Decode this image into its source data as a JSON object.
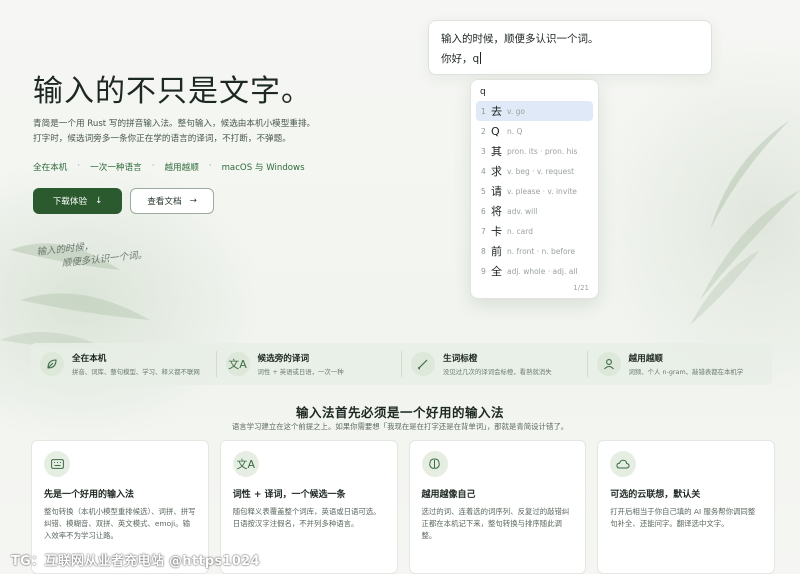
{
  "hero": {
    "title": "输入的不只是文字。",
    "desc_line1": "青简是一个用 Rust 写的拼音输入法。整句输入，候选由本机小模型重排。",
    "desc_line2": "打字时，候选词旁多一条你正在学的语言的译词，不打断，不弹题。",
    "features": [
      "全在本机",
      "一次一种语言",
      "越用越顺",
      "macOS 与 Windows"
    ],
    "download_label": "下载体验",
    "docs_label": "查看文档",
    "handwriting_line1": "输入的时候，",
    "handwriting_line2": "顺便多认识一个词。"
  },
  "demo": {
    "line1": "输入的时候，顺便多认识一个词。",
    "line2": "你好，q",
    "candidate_input": "q",
    "candidates": [
      {
        "num": "1",
        "word": "去",
        "gloss": "v. go"
      },
      {
        "num": "2",
        "word": "Q",
        "gloss": "n. Q"
      },
      {
        "num": "3",
        "word": "其",
        "gloss": "pron. its · pron. his"
      },
      {
        "num": "4",
        "word": "求",
        "gloss": "v. beg · v. request"
      },
      {
        "num": "5",
        "word": "请",
        "gloss": "v. please · v. invite"
      },
      {
        "num": "6",
        "word": "将",
        "gloss": "adv. will"
      },
      {
        "num": "7",
        "word": "卡",
        "gloss": "n. card"
      },
      {
        "num": "8",
        "word": "前",
        "gloss": "n. front · n. before"
      },
      {
        "num": "9",
        "word": "全",
        "gloss": "adj. whole · adj. all"
      }
    ],
    "page": "1/21"
  },
  "strip": [
    {
      "icon": "leaf-icon",
      "title": "全在本机",
      "desc": "拼音、词库、整句模型、学习、释义都不联网"
    },
    {
      "icon": "translate-icon",
      "title": "候选旁的译词",
      "desc": "词性 + 英语或日语，一次一种"
    },
    {
      "icon": "brush-icon",
      "title": "生词标橙",
      "desc": "没见过几次的译词会标橙，看熟就消失"
    },
    {
      "icon": "user-icon",
      "title": "越用越顺",
      "desc": "词频、个人 n-gram、敲错表都在本机学"
    }
  ],
  "section": {
    "title": "输入法首先必须是一个好用的输入法",
    "subtitle": "语言学习建立在这个前提之上。如果你需要想「我现在是在打字还是在背单词」，那就是青简设计错了。"
  },
  "cards": [
    {
      "icon": "keyboard-icon",
      "title": "先是一个好用的输入法",
      "desc": "整句转换（本机小模型重排候选）、词拼、拼写纠错、模糊音、双拼、英文模式、emoji。输入效率不为学习让路。"
    },
    {
      "icon": "translate-icon",
      "title": "词性 + 译词，一个候选一条",
      "desc": "随包释义表覆盖整个词库，英语或日语可选。日语按汉字注假名，不并列多种语言。"
    },
    {
      "icon": "brain-icon",
      "title": "越用越像自己",
      "desc": "选过的词、连着选的词序列、反复过的敲错纠正都在本机记下来，整句转换与排序随此调整。"
    },
    {
      "icon": "cloud-icon",
      "title": "可选的云联想，默认关",
      "desc": "打开后相当于你自己填的 AI 服务帮你调同整句补全、还能问字。翻译选中文字。"
    }
  ],
  "watermark": "TG：互联网从业者充电站 @https1024",
  "colors": {
    "primary": "#2b5a2f",
    "accent": "#3c6b44",
    "highlight": "#dfe9f8"
  }
}
